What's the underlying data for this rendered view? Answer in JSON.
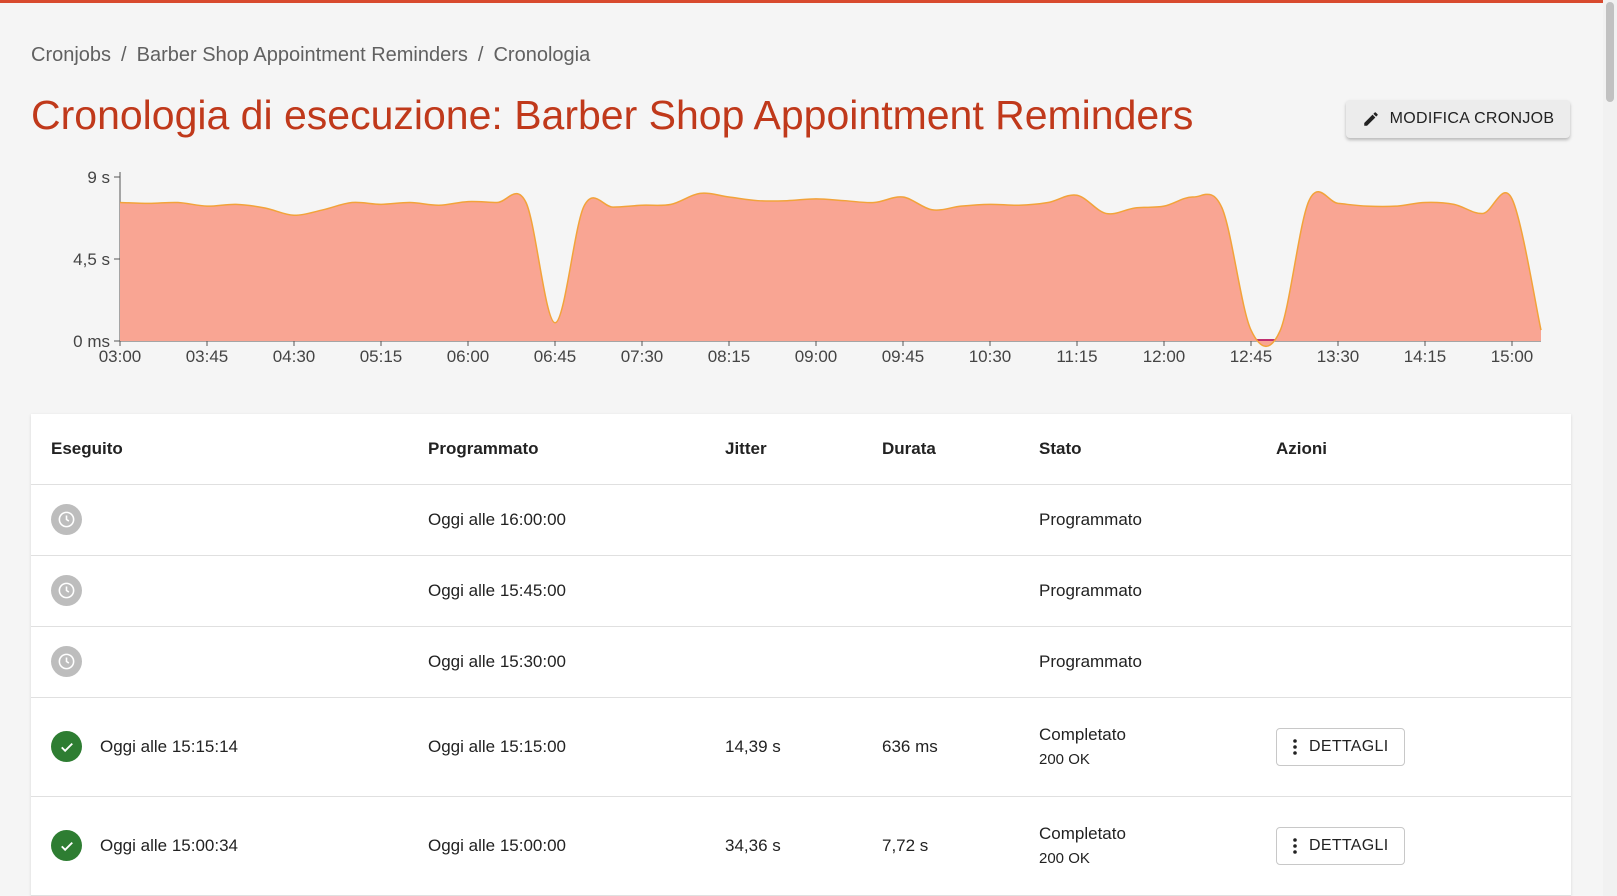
{
  "breadcrumb": {
    "items": [
      "Cronjobs",
      "Barber Shop Appointment Reminders",
      "Cronologia"
    ],
    "separator": "/"
  },
  "page": {
    "title": "Cronologia di esecuzione: Barber Shop Appointment Reminders"
  },
  "toolbar": {
    "edit_label": "MODIFICA CRONJOB"
  },
  "colors": {
    "accent": "#c0391b",
    "area_fill": "#f9a593",
    "area_stroke": "#f2a33a",
    "success": "#2e7d32",
    "pending": "#bdbdbd"
  },
  "chart_data": {
    "type": "area",
    "x": [
      "03:00",
      "03:15",
      "03:30",
      "03:45",
      "04:00",
      "04:15",
      "04:30",
      "04:45",
      "05:00",
      "05:15",
      "05:30",
      "05:45",
      "06:00",
      "06:15",
      "06:30",
      "06:45",
      "07:00",
      "07:15",
      "07:30",
      "07:45",
      "08:00",
      "08:15",
      "08:30",
      "08:45",
      "09:00",
      "09:15",
      "09:30",
      "09:45",
      "10:00",
      "10:15",
      "10:30",
      "10:45",
      "11:00",
      "11:15",
      "11:30",
      "11:45",
      "12:00",
      "12:15",
      "12:30",
      "12:45",
      "13:00",
      "13:15",
      "13:30",
      "13:45",
      "14:00",
      "14:15",
      "14:30",
      "14:45",
      "15:00",
      "15:15"
    ],
    "values": [
      7.6,
      7.55,
      7.6,
      7.4,
      7.5,
      7.3,
      6.9,
      7.2,
      7.6,
      7.5,
      7.6,
      7.45,
      7.65,
      7.6,
      7.6,
      1.0,
      7.4,
      7.35,
      7.45,
      7.5,
      8.1,
      7.9,
      7.7,
      7.7,
      7.8,
      7.7,
      7.6,
      7.9,
      7.2,
      7.4,
      7.5,
      7.45,
      7.6,
      8.0,
      7.0,
      7.3,
      7.4,
      7.9,
      7.3,
      0.6,
      0.55,
      7.7,
      7.55,
      7.4,
      7.4,
      7.6,
      7.5,
      7.0,
      7.8,
      0.6
    ],
    "ylim": [
      0,
      9
    ],
    "y_ticks": [
      "0 ms",
      "4,5 s",
      "9 s"
    ],
    "x_ticks": [
      "03:00",
      "03:45",
      "04:30",
      "05:15",
      "06:00",
      "06:45",
      "07:30",
      "08:15",
      "09:00",
      "09:45",
      "10:30",
      "11:15",
      "12:00",
      "12:45",
      "13:30",
      "14:15",
      "15:00"
    ]
  },
  "table": {
    "headers": [
      "Eseguito",
      "Programmato",
      "Jitter",
      "Durata",
      "Stato",
      "Azioni"
    ],
    "rows": [
      {
        "executed": "",
        "scheduled": "Oggi alle 16:00:00",
        "jitter": "",
        "duration": "",
        "status": "Programmato",
        "http": "",
        "action": ""
      },
      {
        "executed": "",
        "scheduled": "Oggi alle 15:45:00",
        "jitter": "",
        "duration": "",
        "status": "Programmato",
        "http": "",
        "action": ""
      },
      {
        "executed": "",
        "scheduled": "Oggi alle 15:30:00",
        "jitter": "",
        "duration": "",
        "status": "Programmato",
        "http": "",
        "action": ""
      },
      {
        "executed": "Oggi alle 15:15:14",
        "scheduled": "Oggi alle 15:15:00",
        "jitter": "14,39 s",
        "duration": "636 ms",
        "status": "Completato",
        "http": "200 OK",
        "action": "DETTAGLI"
      },
      {
        "executed": "Oggi alle 15:00:34",
        "scheduled": "Oggi alle 15:00:00",
        "jitter": "34,36 s",
        "duration": "7,72 s",
        "status": "Completato",
        "http": "200 OK",
        "action": "DETTAGLI"
      }
    ]
  }
}
